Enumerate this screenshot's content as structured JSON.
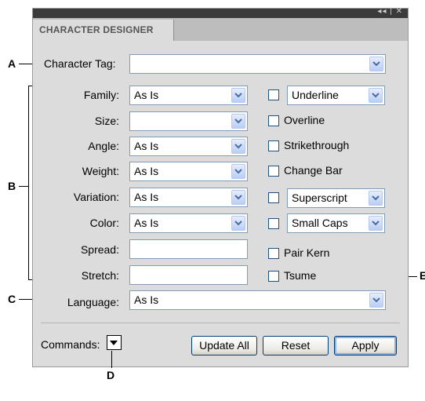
{
  "panel": {
    "tab_label": "CHARACTER DESIGNER",
    "controls_glyph": "◂◂ | ✕"
  },
  "fields": {
    "character_tag": {
      "label": "Character Tag:",
      "value": ""
    },
    "family": {
      "label": "Family:",
      "value": "As Is"
    },
    "size": {
      "label": "Size:",
      "value": ""
    },
    "angle": {
      "label": "Angle:",
      "value": "As Is"
    },
    "weight": {
      "label": "Weight:",
      "value": "As Is"
    },
    "variation": {
      "label": "Variation:",
      "value": "As Is"
    },
    "color": {
      "label": "Color:",
      "value": "As Is"
    },
    "spread": {
      "label": "Spread:",
      "value": ""
    },
    "stretch": {
      "label": "Stretch:",
      "value": ""
    },
    "language": {
      "label": "Language:",
      "value": "As Is"
    }
  },
  "checks": {
    "underline": {
      "label": "Underline",
      "checked": false
    },
    "overline": {
      "label": "Overline",
      "checked": false
    },
    "strikethrough": {
      "label": "Strikethrough",
      "checked": false
    },
    "change_bar": {
      "label": "Change Bar",
      "checked": false
    },
    "superscript": {
      "label": "Superscript",
      "checked": false
    },
    "small_caps": {
      "label": "Small Caps",
      "checked": false
    },
    "pair_kern": {
      "label": "Pair Kern",
      "checked": false
    },
    "tsume": {
      "label": "Tsume",
      "checked": false
    }
  },
  "footer": {
    "commands_label": "Commands:",
    "update_all": "Update All",
    "reset": "Reset",
    "apply": "Apply"
  },
  "callouts": {
    "a": "A",
    "b": "B",
    "c": "C",
    "d": "D",
    "e": "E"
  },
  "colors": {
    "title_bar": "#3b3b3b",
    "panel_bg": "#dcdcdc",
    "field_border": "#7f9db9",
    "dropdown_btn": "#b9cdf5"
  }
}
